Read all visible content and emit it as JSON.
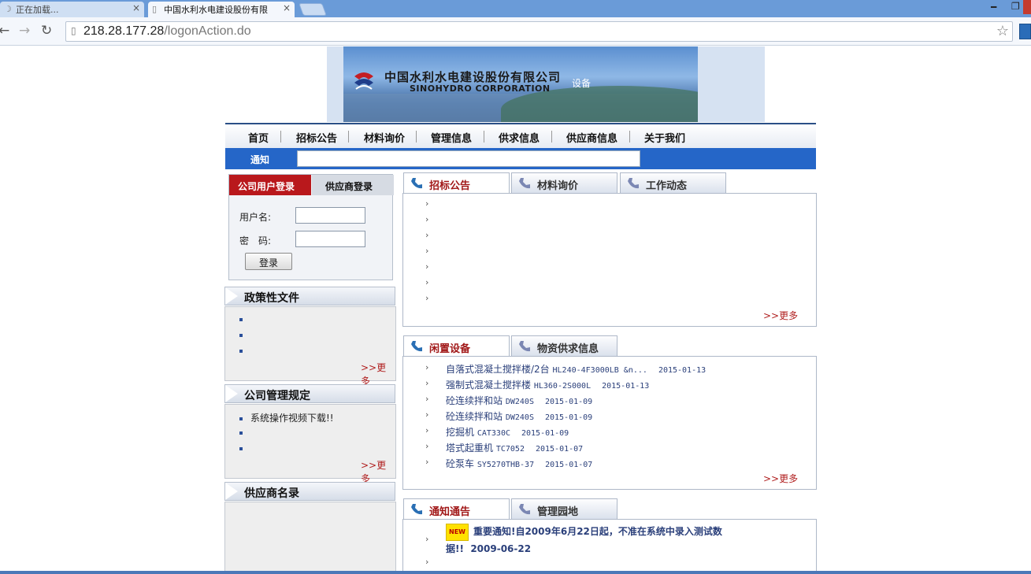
{
  "browser": {
    "tabs": [
      {
        "label": "正在加载...",
        "active": false
      },
      {
        "label": "中国水利水电建设股份有限",
        "active": true
      }
    ],
    "url_host": "218.28.177.28",
    "url_path": "/logonAction.do"
  },
  "banner": {
    "company_cn": "中国水利水电建设股份有限公司",
    "company_en": "SINOHYDRO CORPORATION",
    "word": "设备"
  },
  "nav": {
    "items": [
      "首页",
      "招标公告",
      "材料询价",
      "管理信息",
      "供求信息",
      "供应商信息",
      "关于我们"
    ]
  },
  "notice": {
    "label": "通知"
  },
  "login": {
    "tab_company": "公司用户登录",
    "tab_supplier": "供应商登录",
    "username_label": "用户名:",
    "password_label": "密　码:",
    "submit": "登录"
  },
  "sidebar": {
    "policy": {
      "title": "政策性文件",
      "items": [
        "",
        "",
        ""
      ],
      "more": ">>更多"
    },
    "rules": {
      "title": "公司管理规定",
      "items": [
        "系统操作视频下载!!",
        "",
        ""
      ],
      "more": ">>更多"
    },
    "suppliers": {
      "title": "供应商名录"
    }
  },
  "panel1": {
    "tabs": [
      "招标公告",
      "材料询价",
      "工作动态"
    ],
    "more": ">>更多"
  },
  "panel2": {
    "tabs": [
      "闲置设备",
      "物资供求信息"
    ],
    "items": [
      {
        "name": "自落式混凝土搅拌楼/2台",
        "code": "HL240-4F3000LB &n...",
        "date": "2015-01-13"
      },
      {
        "name": "强制式混凝土搅拌楼",
        "code": "HL360-2S000L",
        "date": "2015-01-13"
      },
      {
        "name": "砼连续拌和站",
        "code": "DW240S",
        "date": "2015-01-09"
      },
      {
        "name": "砼连续拌和站",
        "code": "DW240S",
        "date": "2015-01-09"
      },
      {
        "name": "挖掘机",
        "code": "CAT330C",
        "date": "2015-01-09"
      },
      {
        "name": "塔式起重机",
        "code": "TC7052",
        "date": "2015-01-07"
      },
      {
        "name": "砼泵车",
        "code": "SY5270THB-37",
        "date": "2015-01-07"
      }
    ],
    "more": ">>更多"
  },
  "panel3": {
    "tabs": [
      "通知通告",
      "管理园地"
    ],
    "badge": "NEW",
    "entry_text": "重要通知!自2009年6月22日起，不准在系统中录入测试数据!!",
    "entry_date": "2009-06-22"
  },
  "colors": {
    "nav_accent": "#2566c8",
    "login_tab": "#b9181c",
    "more_link": "#b01e1e"
  }
}
